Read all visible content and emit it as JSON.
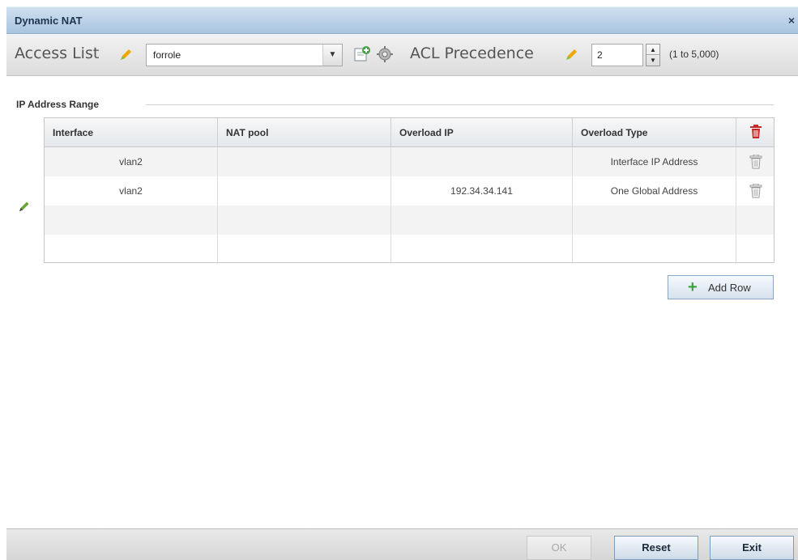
{
  "dialog": {
    "title": "Dynamic NAT",
    "close_label": "×"
  },
  "toolbar": {
    "access_list_label": "Access List",
    "access_list_value": "forrole",
    "acl_precedence_label": "ACL Precedence",
    "acl_precedence_value": "2",
    "acl_precedence_hint": "(1 to 5,000)"
  },
  "section": {
    "label": "IP Address Range"
  },
  "table": {
    "columns": [
      "Interface",
      "NAT pool",
      "Overload IP",
      "Overload Type"
    ],
    "rows": [
      {
        "interface": "vlan2",
        "nat_pool": "",
        "overload_ip": "",
        "overload_type": "Interface IP Address"
      },
      {
        "interface": "vlan2",
        "nat_pool": "",
        "overload_ip": "192.34.34.141",
        "overload_type": "One Global Address"
      }
    ]
  },
  "buttons": {
    "add_row": "Add Row",
    "ok": "OK",
    "reset": "Reset",
    "exit": "Exit"
  },
  "colors": {
    "accent": "#a9c4df",
    "delete_red": "#c62828",
    "plus_green": "#3aa43a"
  }
}
